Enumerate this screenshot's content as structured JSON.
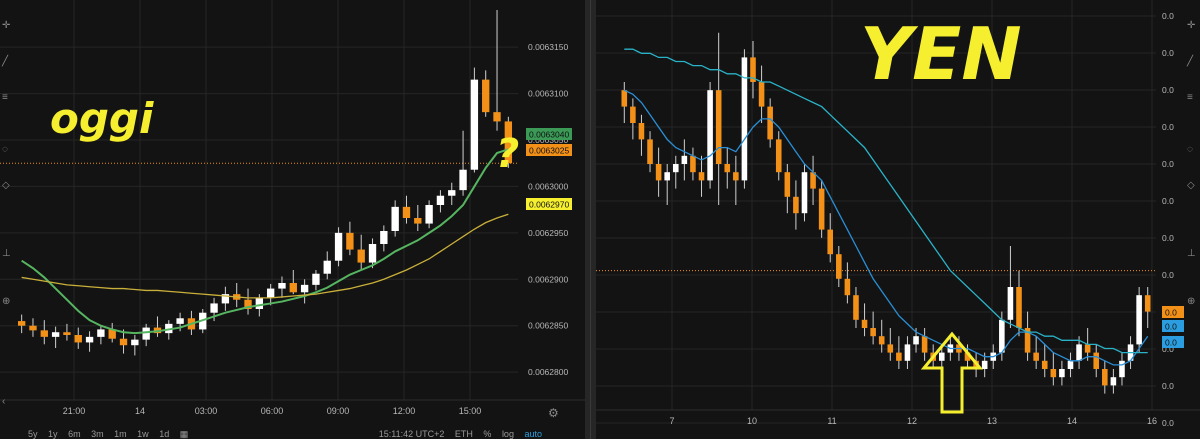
{
  "left_panel": {
    "overlay_text": "oggi",
    "question_text": "?",
    "toolbar": {
      "ranges": [
        "5y",
        "1y",
        "6m",
        "3m",
        "1m",
        "1w",
        "1d"
      ],
      "clock": "15:11:42 UTC+2",
      "pair": "ETH",
      "percent": "%",
      "log": "log",
      "auto": "auto"
    },
    "price_tags": [
      {
        "text": "0.0063040",
        "color": "#3a9a56"
      },
      {
        "text": "0.0063025",
        "color": "#f29018"
      },
      {
        "text": "0.0062970",
        "color": "#f5ef2f"
      }
    ]
  },
  "right_panel": {
    "overlay_text": "YEN",
    "arrow_color": "#f5ef2f",
    "axis_tick_labels": [
      "0.0",
      "0.0",
      "0.0",
      "0.0",
      "0.0",
      "0.0",
      "0.0",
      "0.0",
      "0.0",
      "0.0",
      "0.0",
      "0.0"
    ],
    "price_tags": [
      {
        "text": "0.0",
        "color": "#f29018"
      },
      {
        "text": "0.0",
        "color": "#2a9ee0"
      },
      {
        "text": "0.0",
        "color": "#2a9ee0"
      }
    ]
  },
  "colors": {
    "bull": "#ffffff",
    "bear": "#f29018",
    "ma_fast": "#56b560",
    "ma_slow": "#c9b03a",
    "ma_blue_fast": "#2a8fd6",
    "ma_blue_slow": "#2ab3c8",
    "background": "#131313",
    "grid": "#262626"
  },
  "chart_data": [
    {
      "type": "candlestick",
      "x_tick_labels": [
        "21:00",
        "14",
        "03:00",
        "06:00",
        "09:00",
        "12:00",
        "15:00"
      ],
      "y_tick_labels": [
        "0.0063150",
        "0.0063100",
        "0.0063050",
        "0.0063000",
        "0.0062950",
        "0.0062900",
        "0.0062850",
        "0.0062800"
      ],
      "y_ticks": [
        0.006315,
        0.00631,
        0.006305,
        0.0063,
        0.006295,
        0.00629,
        0.006285,
        0.00628
      ],
      "ylim": [
        0.006277,
        0.006319
      ],
      "grid": true,
      "last_price": 0.0063025,
      "candles": [
        [
          0.0062855,
          0.0062862,
          0.0062842,
          0.006285
        ],
        [
          0.006285,
          0.0062858,
          0.0062838,
          0.0062845
        ],
        [
          0.0062845,
          0.0062856,
          0.006283,
          0.0062838
        ],
        [
          0.0062838,
          0.0062849,
          0.0062826,
          0.0062843
        ],
        [
          0.0062843,
          0.0062852,
          0.0062834,
          0.006284
        ],
        [
          0.006284,
          0.0062848,
          0.0062825,
          0.0062832
        ],
        [
          0.0062832,
          0.0062844,
          0.0062822,
          0.0062838
        ],
        [
          0.0062838,
          0.006285,
          0.006283,
          0.0062846
        ],
        [
          0.0062846,
          0.0062853,
          0.0062832,
          0.0062836
        ],
        [
          0.0062836,
          0.0062846,
          0.006282,
          0.0062829
        ],
        [
          0.0062829,
          0.006284,
          0.0062818,
          0.0062835
        ],
        [
          0.0062835,
          0.0062852,
          0.0062828,
          0.0062848
        ],
        [
          0.0062848,
          0.006286,
          0.0062838,
          0.0062842
        ],
        [
          0.0062842,
          0.0062856,
          0.0062835,
          0.0062852
        ],
        [
          0.0062852,
          0.0062864,
          0.0062844,
          0.0062858
        ],
        [
          0.0062858,
          0.0062866,
          0.006284,
          0.0062846
        ],
        [
          0.0062846,
          0.0062868,
          0.0062842,
          0.0062864
        ],
        [
          0.0062864,
          0.006288,
          0.0062855,
          0.0062874
        ],
        [
          0.0062874,
          0.0062892,
          0.0062866,
          0.0062884
        ],
        [
          0.0062884,
          0.0062896,
          0.006287,
          0.0062878
        ],
        [
          0.0062878,
          0.006289,
          0.0062862,
          0.0062868
        ],
        [
          0.0062868,
          0.0062884,
          0.006286,
          0.006288
        ],
        [
          0.006288,
          0.0062895,
          0.0062872,
          0.006289
        ],
        [
          0.006289,
          0.0062903,
          0.006288,
          0.0062896
        ],
        [
          0.0062896,
          0.006291,
          0.0062884,
          0.0062886
        ],
        [
          0.0062886,
          0.00629,
          0.0062874,
          0.0062894
        ],
        [
          0.0062894,
          0.006291,
          0.0062888,
          0.0062906
        ],
        [
          0.0062906,
          0.006293,
          0.00629,
          0.006292
        ],
        [
          0.006292,
          0.0062956,
          0.0062914,
          0.006295
        ],
        [
          0.006295,
          0.0062962,
          0.0062926,
          0.0062932
        ],
        [
          0.0062932,
          0.0062948,
          0.006291,
          0.0062918
        ],
        [
          0.0062918,
          0.0062944,
          0.0062912,
          0.0062938
        ],
        [
          0.0062938,
          0.0062958,
          0.006293,
          0.0062952
        ],
        [
          0.0062952,
          0.0062985,
          0.0062946,
          0.0062978
        ],
        [
          0.0062978,
          0.006299,
          0.006296,
          0.0062966
        ],
        [
          0.0062966,
          0.006298,
          0.0062952,
          0.006296
        ],
        [
          0.006296,
          0.0062985,
          0.0062955,
          0.006298
        ],
        [
          0.006298,
          0.0062996,
          0.0062972,
          0.006299
        ],
        [
          0.006299,
          0.0063004,
          0.006298,
          0.0062996
        ],
        [
          0.0062996,
          0.006306,
          0.006299,
          0.0063018
        ],
        [
          0.0063018,
          0.0063128,
          0.0063015,
          0.0063115
        ],
        [
          0.0063115,
          0.0063125,
          0.0063075,
          0.006308
        ],
        [
          0.006308,
          0.006319,
          0.006306,
          0.006307
        ],
        [
          0.006307,
          0.0063075,
          0.006302,
          0.0063025
        ]
      ],
      "series": [
        {
          "kind": "ma_fast",
          "values": [
            0.006292,
            0.0062912,
            0.0062902,
            0.006289,
            0.0062878,
            0.0062866,
            0.0062856,
            0.006285,
            0.0062846,
            0.0062843,
            0.0062842,
            0.0062843,
            0.0062844,
            0.0062846,
            0.0062848,
            0.0062852,
            0.0062856,
            0.006286,
            0.0062864,
            0.0062867,
            0.006287,
            0.0062872,
            0.0062874,
            0.0062876,
            0.0062879,
            0.0062882,
            0.0062886,
            0.0062891,
            0.0062898,
            0.0062905,
            0.006291,
            0.0062915,
            0.0062922,
            0.006293,
            0.0062936,
            0.0062942,
            0.006295,
            0.0062958,
            0.0062968,
            0.006298,
            0.0063,
            0.006302,
            0.0063036,
            0.006304
          ]
        },
        {
          "kind": "ma_slow",
          "values": [
            0.0062902,
            0.00629,
            0.0062898,
            0.0062896,
            0.0062894,
            0.0062893,
            0.0062892,
            0.0062891,
            0.006289,
            0.006289,
            0.0062889,
            0.0062888,
            0.0062888,
            0.0062887,
            0.0062886,
            0.0062885,
            0.0062884,
            0.0062883,
            0.0062882,
            0.0062881,
            0.006288,
            0.006288,
            0.006288,
            0.0062881,
            0.0062882,
            0.0062883,
            0.0062884,
            0.0062886,
            0.0062888,
            0.006289,
            0.0062893,
            0.0062896,
            0.00629,
            0.0062905,
            0.006291,
            0.0062916,
            0.0062922,
            0.006293,
            0.0062938,
            0.0062946,
            0.0062954,
            0.0062961,
            0.0062966,
            0.006297
          ]
        }
      ]
    },
    {
      "type": "candlestick",
      "x_tick_labels": [
        "7",
        "10",
        "11",
        "12",
        "13",
        "14",
        "16"
      ],
      "ylim": [
        0,
        100
      ],
      "grid": true,
      "last_price": 34,
      "candles": [
        [
          78,
          80,
          70,
          74
        ],
        [
          74,
          76,
          66,
          70
        ],
        [
          70,
          72,
          62,
          66
        ],
        [
          66,
          68,
          58,
          60
        ],
        [
          60,
          64,
          52,
          56
        ],
        [
          56,
          60,
          50,
          58
        ],
        [
          58,
          62,
          54,
          60
        ],
        [
          60,
          66,
          56,
          62
        ],
        [
          62,
          64,
          56,
          58
        ],
        [
          58,
          62,
          52,
          56
        ],
        [
          56,
          80,
          54,
          78
        ],
        [
          78,
          92,
          50,
          60
        ],
        [
          60,
          64,
          54,
          58
        ],
        [
          58,
          62,
          50,
          56
        ],
        [
          56,
          88,
          54,
          86
        ],
        [
          86,
          90,
          76,
          80
        ],
        [
          80,
          84,
          70,
          74
        ],
        [
          74,
          76,
          64,
          66
        ],
        [
          66,
          68,
          56,
          58
        ],
        [
          58,
          60,
          48,
          52
        ],
        [
          52,
          56,
          44,
          48
        ],
        [
          48,
          60,
          46,
          58
        ],
        [
          58,
          62,
          50,
          54
        ],
        [
          54,
          56,
          42,
          44
        ],
        [
          44,
          48,
          36,
          38
        ],
        [
          38,
          40,
          30,
          32
        ],
        [
          32,
          36,
          26,
          28
        ],
        [
          28,
          30,
          20,
          22
        ],
        [
          22,
          26,
          18,
          20
        ],
        [
          20,
          24,
          16,
          18
        ],
        [
          18,
          22,
          14,
          16
        ],
        [
          16,
          20,
          12,
          14
        ],
        [
          14,
          18,
          10,
          12
        ],
        [
          12,
          18,
          10,
          16
        ],
        [
          16,
          20,
          14,
          18
        ],
        [
          18,
          20,
          12,
          14
        ],
        [
          14,
          16,
          10,
          12
        ],
        [
          12,
          16,
          10,
          14
        ],
        [
          14,
          18,
          12,
          16
        ],
        [
          16,
          18,
          12,
          14
        ],
        [
          14,
          16,
          10,
          12
        ],
        [
          12,
          14,
          8,
          10
        ],
        [
          10,
          14,
          8,
          12
        ],
        [
          12,
          16,
          10,
          14
        ],
        [
          14,
          24,
          12,
          22
        ],
        [
          22,
          40,
          20,
          30
        ],
        [
          30,
          34,
          18,
          20
        ],
        [
          20,
          24,
          12,
          14
        ],
        [
          14,
          18,
          10,
          12
        ],
        [
          12,
          16,
          8,
          10
        ],
        [
          10,
          14,
          6,
          8
        ],
        [
          8,
          12,
          6,
          10
        ],
        [
          10,
          14,
          8,
          12
        ],
        [
          12,
          18,
          10,
          16
        ],
        [
          16,
          20,
          12,
          14
        ],
        [
          14,
          16,
          8,
          10
        ],
        [
          10,
          12,
          4,
          6
        ],
        [
          6,
          10,
          4,
          8
        ],
        [
          8,
          14,
          6,
          12
        ],
        [
          12,
          18,
          10,
          16
        ],
        [
          16,
          30,
          14,
          28
        ],
        [
          28,
          30,
          20,
          24
        ]
      ],
      "series": [
        {
          "kind": "ma_blue_fast",
          "values": [
            78,
            77,
            75,
            72,
            69,
            66,
            64,
            63,
            62,
            61,
            62,
            64,
            64,
            63,
            66,
            69,
            71,
            71,
            69,
            66,
            63,
            60,
            58,
            56,
            52,
            48,
            44,
            40,
            36,
            32,
            29,
            26,
            23,
            21,
            19,
            18,
            17,
            16,
            15,
            15,
            15,
            14,
            13,
            13,
            14,
            17,
            19,
            19,
            18,
            16,
            14,
            13,
            12,
            12,
            13,
            13,
            12,
            11,
            11,
            12,
            15,
            18
          ]
        },
        {
          "kind": "ma_blue_slow",
          "values": [
            88,
            88,
            87,
            87,
            86,
            86,
            85,
            85,
            84,
            84,
            83,
            83,
            82,
            82,
            81,
            81,
            80,
            80,
            79,
            78,
            77,
            76,
            75,
            74,
            72,
            70,
            68,
            66,
            64,
            61,
            58,
            55,
            52,
            49,
            46,
            43,
            40,
            37,
            34,
            32,
            30,
            28,
            26,
            24,
            22,
            21,
            20,
            19,
            19,
            18,
            18,
            17,
            17,
            17,
            16,
            16,
            15,
            15,
            14,
            14,
            14,
            14
          ]
        }
      ]
    }
  ]
}
